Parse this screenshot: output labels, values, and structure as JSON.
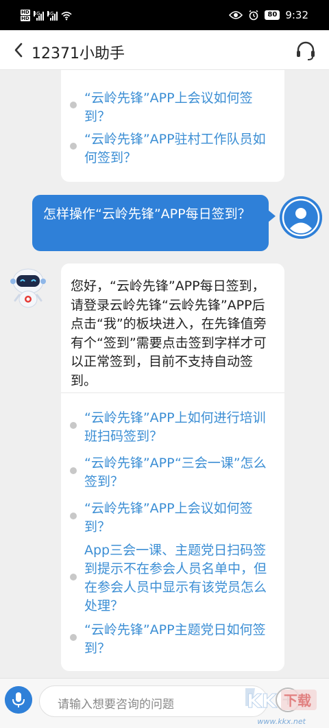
{
  "status_bar": {
    "left_badges": [
      "HD",
      "HD"
    ],
    "network1": "4G",
    "network2": "4G",
    "battery": "80",
    "time": "9:32"
  },
  "header": {
    "title": "12371小助手",
    "back_icon": "chevron-left-icon",
    "service_icon": "headset-icon"
  },
  "chat": {
    "previous_card": {
      "questions": [
        "“云岭先锋”APP上会议如何签到？",
        "“云岭先锋”APP驻村工作队员如何签到？"
      ]
    },
    "user_message": "怎样操作“云岭先锋”APP每日签到？",
    "bot_answer": "您好，“云岭先锋”APP每日签到，请登录云岭先锋“云岭先锋”APP后点击“我”的板块进入，在先锋值旁有个“签到”需要点击签到字样才可以正常签到，目前不支持自动签到。",
    "related_questions": [
      "“云岭先锋”APP上如何进行培训班扫码签到？",
      "“云岭先锋”APP“三会一课”怎么签到？",
      "“云岭先锋”APP上会议如何签到？",
      "App三会一课、主题党日扫码签到提示不在参会人员名单中，但在参会人员中显示有该党员怎么处理？",
      "“云岭先锋”APP主题党日如何签到？"
    ]
  },
  "input_bar": {
    "placeholder": "请输入想要咨询的问题",
    "plus_label": "+"
  },
  "watermark": {
    "brand": "KK下载",
    "url": "www.kkx.net"
  },
  "colors": {
    "accent": "#2f80d8",
    "link": "#3b8ed4",
    "background": "#efefef"
  }
}
